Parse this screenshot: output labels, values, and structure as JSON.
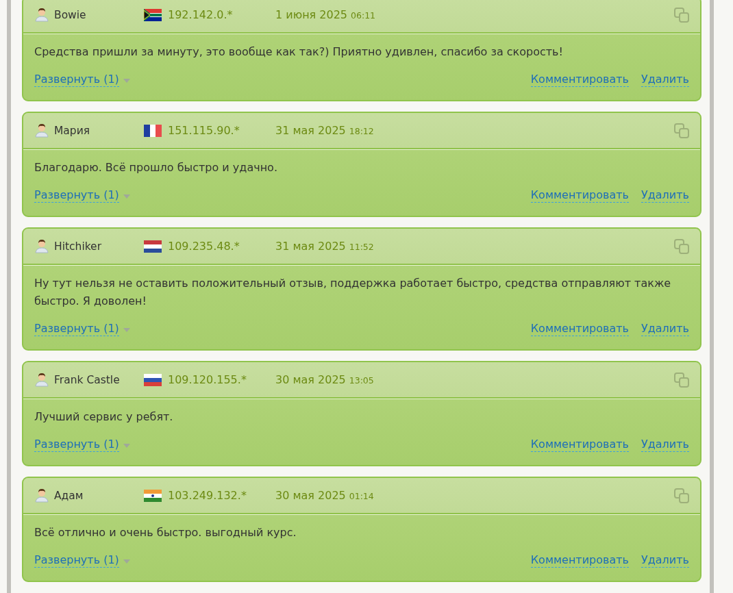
{
  "reviews": [
    {
      "author": "Bowie",
      "kind": "za",
      "ip": "192.142.0.*",
      "date": "1 июня 2025",
      "time": "06:11",
      "text": "Средства пришли за минуту, это вообще как так?) Приятно удивлен, спасибо за скорость!",
      "expand": "Развернуть (1)",
      "actions": [
        "Комментировать",
        "Удалить"
      ]
    },
    {
      "author": "Мария",
      "kind": "fr",
      "ip": "151.115.90.*",
      "date": "31 мая 2025",
      "time": "18:12",
      "text": "Благодарю. Всё прошло быстро и удачно.",
      "expand": "Развернуть (1)",
      "actions": [
        "Комментировать",
        "Удалить"
      ]
    },
    {
      "author": "Hitchiker",
      "kind": "nl",
      "ip": "109.235.48.*",
      "date": "31 мая 2025",
      "time": "11:52",
      "text": "Ну тут нельзя не оставить положительный отзыв, поддержка работает быстро, средства отправляют также быстро. Я доволен!",
      "expand": "Развернуть (1)",
      "actions": [
        "Комментировать",
        "Удалить"
      ]
    },
    {
      "author": "Frank Castle",
      "kind": "ru",
      "ip": "109.120.155.*",
      "date": "30 мая 2025",
      "time": "13:05",
      "text": "Лучший сервис у ребят.",
      "expand": "Развернуть (1)",
      "actions": [
        "Комментировать",
        "Удалить"
      ]
    },
    {
      "author": "Адам",
      "kind": "in",
      "ip": "103.249.132.*",
      "date": "30 мая 2025",
      "time": "01:14",
      "text": "Всё отлично и очень быстро. выгодный курс.",
      "expand": "Развернуть (1)",
      "actions": [
        "Комментировать",
        "Удалить"
      ]
    }
  ]
}
